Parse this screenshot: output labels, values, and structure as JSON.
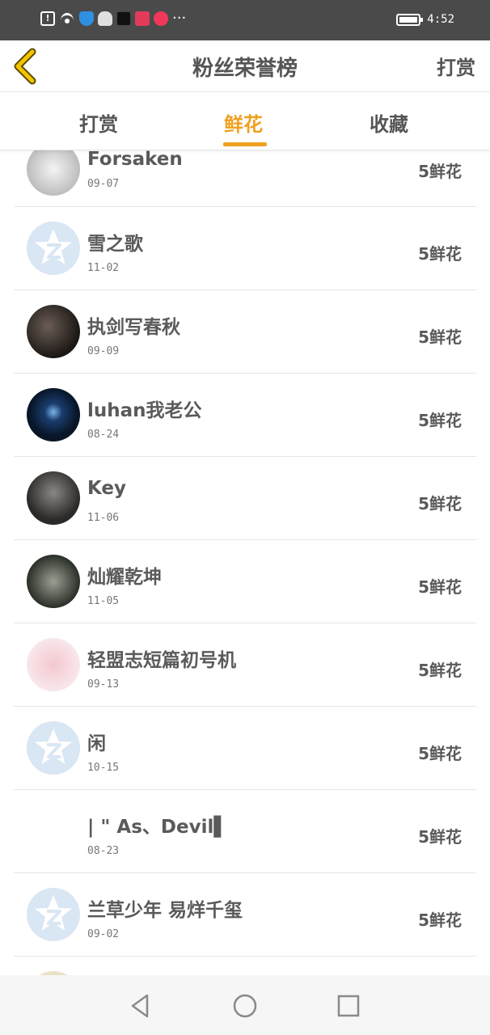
{
  "status_bar": {
    "time": "4:52",
    "more": "···"
  },
  "navbar": {
    "title": "粉丝荣誉榜",
    "action": "打赏"
  },
  "tabs": [
    {
      "label": "打赏"
    },
    {
      "label": "鲜花"
    },
    {
      "label": "收藏"
    }
  ],
  "accent_color": "#f0a020",
  "fans": [
    {
      "name": "Forsaken",
      "date": "09-07",
      "amount": "5鲜花",
      "avatar": "silver"
    },
    {
      "name": "雪之歌",
      "date": "11-02",
      "amount": "5鲜花",
      "avatar": "qq-default"
    },
    {
      "name": "执剑写春秋",
      "date": "09-09",
      "amount": "5鲜花",
      "avatar": "dark1"
    },
    {
      "name": "luhan我老公",
      "date": "08-24",
      "amount": "5鲜花",
      "avatar": "dark2"
    },
    {
      "name": "Key",
      "date": "11-06",
      "amount": "5鲜花",
      "avatar": "dark3"
    },
    {
      "name": "灿耀乾坤",
      "date": "11-05",
      "amount": "5鲜花",
      "avatar": "dark4"
    },
    {
      "name": "轻盟志短篇初号机",
      "date": "09-13",
      "amount": "5鲜花",
      "avatar": "pink"
    },
    {
      "name": "闲",
      "date": "10-15",
      "amount": "5鲜花",
      "avatar": "qq-default"
    },
    {
      "name": "| \" As、Devil▌",
      "date": "08-23",
      "amount": "5鲜花",
      "avatar": "blank"
    },
    {
      "name": "兰草少年 易烊千玺",
      "date": "09-02",
      "amount": "5鲜花",
      "avatar": "qq-default"
    },
    {
      "name": "",
      "date": "",
      "amount": "",
      "avatar": "beige"
    }
  ]
}
